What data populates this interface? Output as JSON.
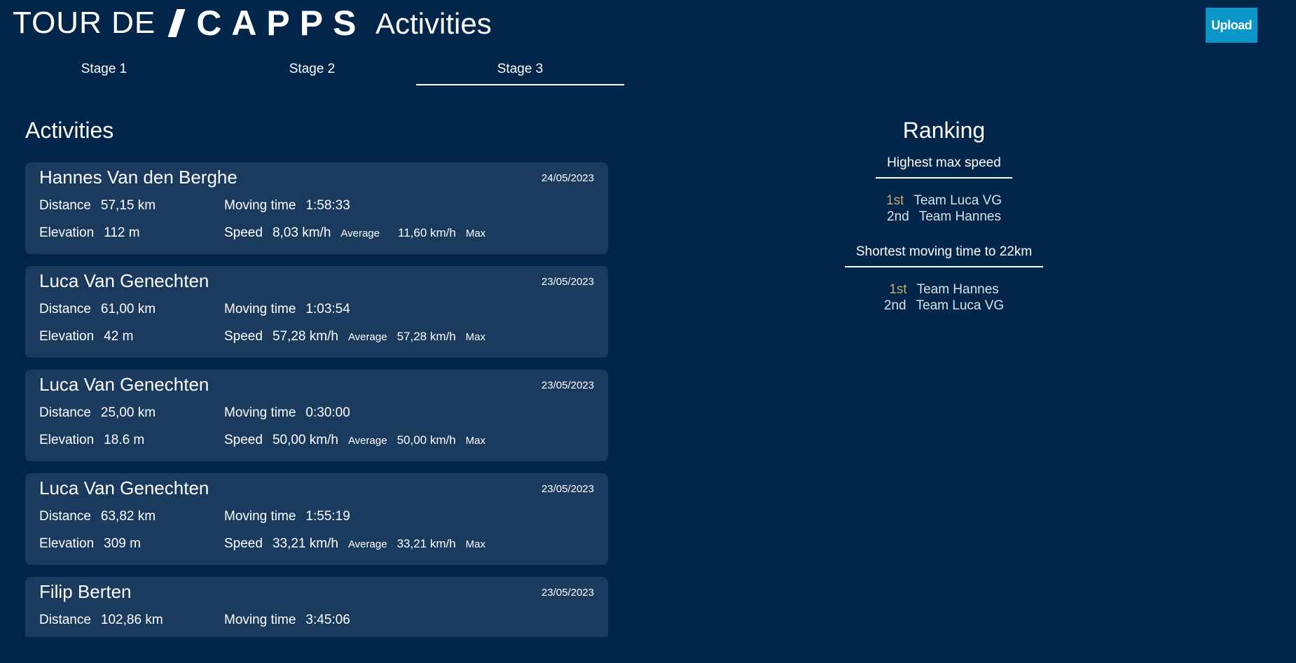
{
  "header": {
    "logo_prefix": "TOUR DE",
    "logo_brand": "CAPPS",
    "title": "Activities",
    "upload_label": "Upload"
  },
  "tabs": [
    {
      "label": "Stage 1",
      "active": false
    },
    {
      "label": "Stage 2",
      "active": false
    },
    {
      "label": "Stage 3",
      "active": true
    }
  ],
  "activities": {
    "title": "Activities",
    "labels": {
      "distance": "Distance",
      "moving_time": "Moving time",
      "elevation": "Elevation",
      "speed": "Speed",
      "average": "Average",
      "max": "Max"
    },
    "items": [
      {
        "name": "Hannes Van den Berghe",
        "date": "24/05/2023",
        "distance": "57,15 km",
        "moving_time": "1:58:33",
        "elevation": "112 m",
        "avg_speed": "8,03 km/h",
        "max_speed": "11,60 km/h"
      },
      {
        "name": "Luca Van Genechten",
        "date": "23/05/2023",
        "distance": "61,00 km",
        "moving_time": "1:03:54",
        "elevation": "42 m",
        "avg_speed": "57,28 km/h",
        "max_speed": "57,28 km/h"
      },
      {
        "name": "Luca Van Genechten",
        "date": "23/05/2023",
        "distance": "25,00 km",
        "moving_time": "0:30:00",
        "elevation": "18.6 m",
        "avg_speed": "50,00 km/h",
        "max_speed": "50,00 km/h"
      },
      {
        "name": "Luca Van Genechten",
        "date": "23/05/2023",
        "distance": "63,82 km",
        "moving_time": "1:55:19",
        "elevation": "309 m",
        "avg_speed": "33,21 km/h",
        "max_speed": "33,21 km/h"
      },
      {
        "name": "Filip Berten",
        "date": "23/05/2023",
        "distance": "102,86 km",
        "moving_time": "3:45:06",
        "elevation": "",
        "avg_speed": "",
        "max_speed": ""
      }
    ]
  },
  "ranking": {
    "title": "Ranking",
    "categories": [
      {
        "label": "Highest max speed",
        "entries": [
          {
            "place": "1st",
            "team": "Team Luca VG"
          },
          {
            "place": "2nd",
            "team": "Team Hannes"
          }
        ]
      },
      {
        "label": "Shortest moving time to 22km",
        "entries": [
          {
            "place": "1st",
            "team": "Team Hannes"
          },
          {
            "place": "2nd",
            "team": "Team Luca VG"
          }
        ]
      }
    ]
  },
  "colors": {
    "background": "#02254a",
    "card": "#1a3a5e",
    "accent": "#0a96c8",
    "gold": "#c9a66b"
  }
}
